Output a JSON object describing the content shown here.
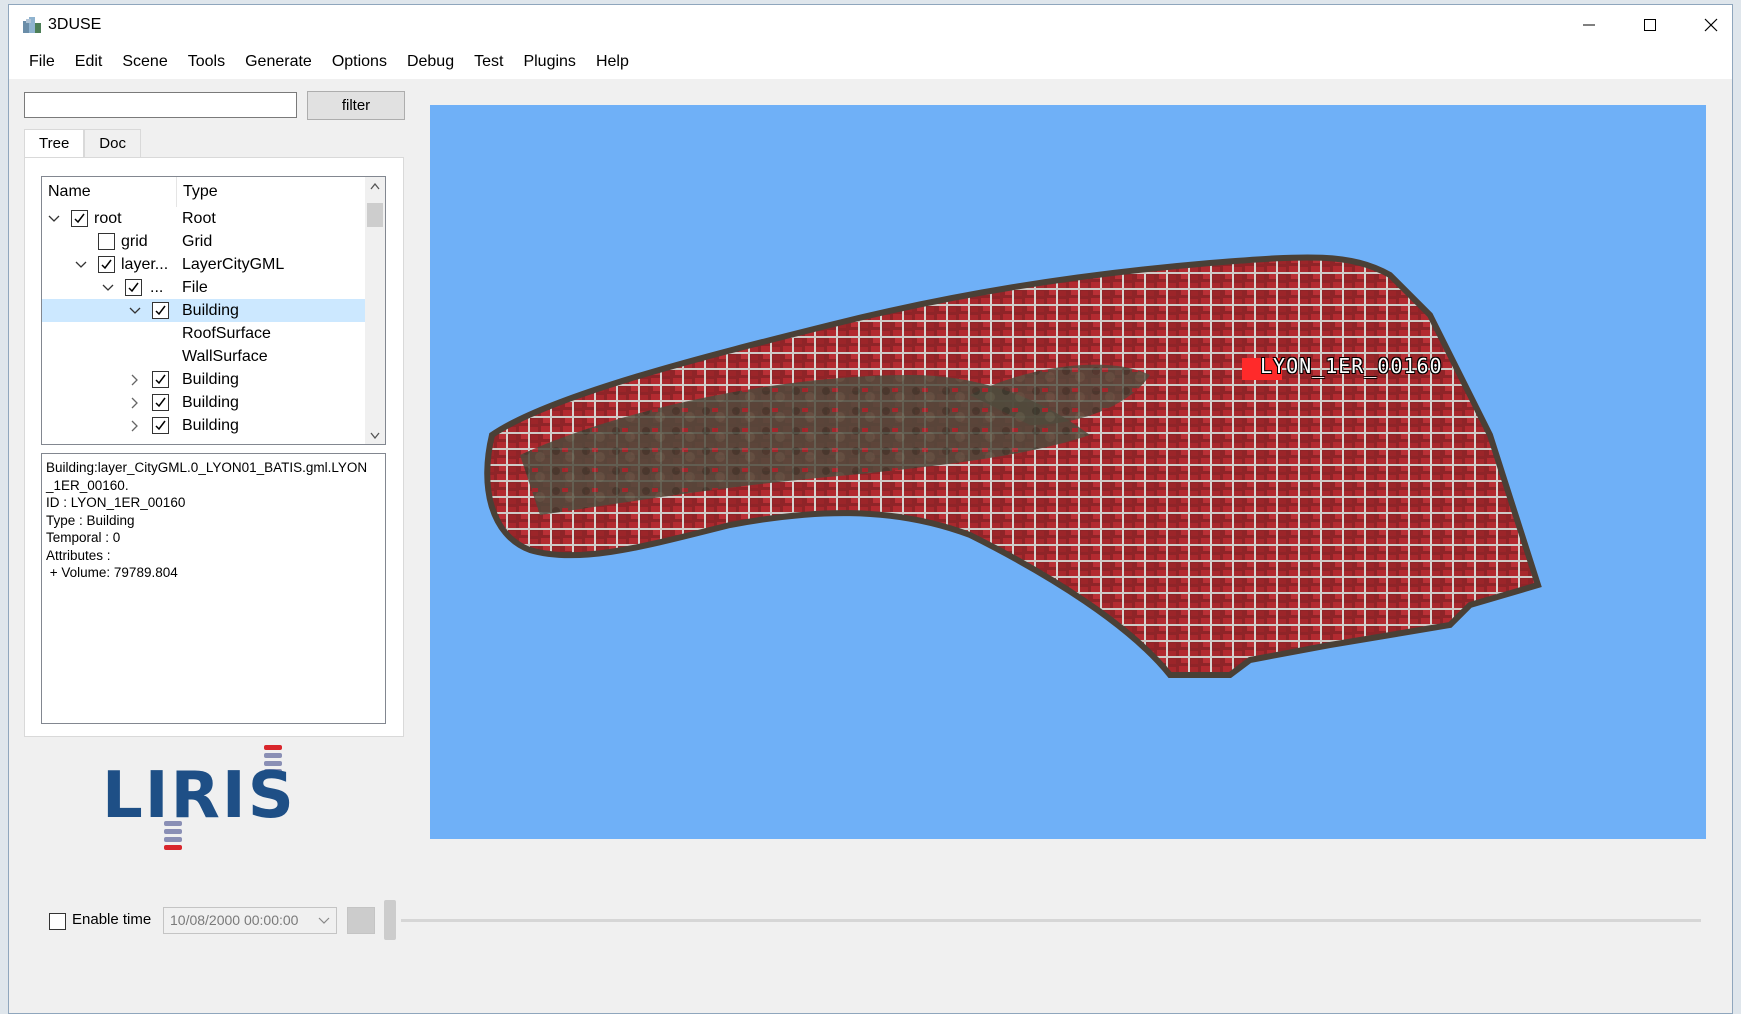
{
  "window": {
    "title": "3DUSE"
  },
  "menu": [
    "File",
    "Edit",
    "Scene",
    "Tools",
    "Generate",
    "Options",
    "Debug",
    "Test",
    "Plugins",
    "Help"
  ],
  "search": {
    "value": "",
    "placeholder": "",
    "filter_label": "filter"
  },
  "tabs": [
    "Tree",
    "Doc"
  ],
  "tree": {
    "headers": {
      "name": "Name",
      "type": "Type"
    },
    "rows": [
      {
        "name": "root",
        "type": "Root"
      },
      {
        "name": "grid",
        "type": "Grid"
      },
      {
        "name": "layer...",
        "type": "LayerCityGML"
      },
      {
        "name": "...",
        "type": "File"
      },
      {
        "name": "",
        "type": "Building"
      },
      {
        "name": "",
        "type": "RoofSurface"
      },
      {
        "name": "",
        "type": "WallSurface"
      },
      {
        "name": "",
        "type": "Building"
      },
      {
        "name": "",
        "type": "Building"
      },
      {
        "name": "",
        "type": "Building"
      }
    ]
  },
  "info": {
    "lines": [
      "Building:layer_CityGML.0_LYON01_BATIS.gml.LYON",
      "_1ER_00160.",
      "ID : LYON_1ER_00160",
      "Type : Building",
      "Temporal : 0",
      "Attributes :",
      " + Volume: 79789.804"
    ]
  },
  "logo": {
    "text": "LIRIS"
  },
  "viewport": {
    "label": "LYON_1ER_00160",
    "background_color": "#6fb0f7",
    "roof_color": "#a3262c"
  },
  "time": {
    "enable_label": "Enable time",
    "date_value": "10/08/2000 00:00:00"
  }
}
